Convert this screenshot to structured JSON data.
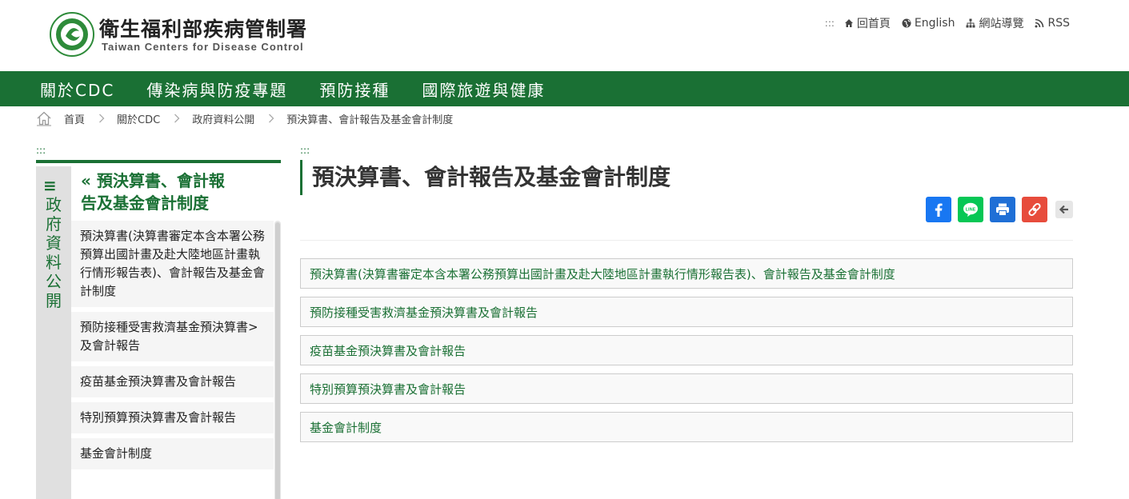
{
  "header": {
    "title": "衛生福利部疾病管制署",
    "subtitle": "Taiwan Centers for Disease Control",
    "top_dots": ":::",
    "top_links": [
      {
        "label": "回首頁",
        "icon": "home-icon"
      },
      {
        "label": "English",
        "icon": "globe-icon"
      },
      {
        "label": "網站導覽",
        "icon": "sitemap-icon"
      },
      {
        "label": "RSS",
        "icon": "rss-icon"
      }
    ]
  },
  "nav": {
    "items": [
      {
        "label": "關於CDC"
      },
      {
        "label": "傳染病與防疫專題"
      },
      {
        "label": "預防接種"
      },
      {
        "label": "國際旅遊與健康"
      }
    ]
  },
  "breadcrumb": [
    {
      "label": "首頁"
    },
    {
      "label": "關於CDC"
    },
    {
      "label": "政府資料公開"
    },
    {
      "label": "預決算書、會計報告及基金會計制度"
    }
  ],
  "sidebar": {
    "dots": ":::",
    "menu_icon": "≡",
    "section_label": "政府資料公開",
    "title": "« 預決算書、會計報告及基金會計制度",
    "items": [
      {
        "label": "預決算書(決算書審定本含本署公務預算出國計畫及赴大陸地區計畫執行情形報告表)、會計報告及基金會計制度"
      },
      {
        "label": "預防接種受害救濟基金預決算書>及會計報告"
      },
      {
        "label": "疫苗基金預決算書及會計報告"
      },
      {
        "label": "特別預算預決算書及會計報告"
      },
      {
        "label": "基金會計制度"
      }
    ]
  },
  "main": {
    "dots": ":::",
    "title": "預決算書、會計報告及基金會計制度",
    "share": [
      {
        "name": "facebook-share",
        "color": "#1877f2",
        "icon": "facebook-icon"
      },
      {
        "name": "line-share",
        "color": "#06c755",
        "icon": "line-icon"
      },
      {
        "name": "print",
        "color": "#1f6fd6",
        "icon": "print-icon"
      },
      {
        "name": "copy-link",
        "color": "#e74c3c",
        "icon": "link-icon"
      }
    ],
    "links": [
      {
        "label": "預決算書(決算書審定本含本署公務預算出國計畫及赴大陸地區計畫執行情形報告表)、會計報告及基金會計制度"
      },
      {
        "label": "預防接種受害救濟基金預決算書及會計報告"
      },
      {
        "label": "疫苗基金預決算書及會計報告"
      },
      {
        "label": "特別預算預決算書及會計報告"
      },
      {
        "label": "基金會計制度"
      }
    ]
  },
  "colors": {
    "brand_green": "#1a7034",
    "sidebar_bg": "#e0e0e0",
    "item_bg": "#f5f5f5"
  }
}
